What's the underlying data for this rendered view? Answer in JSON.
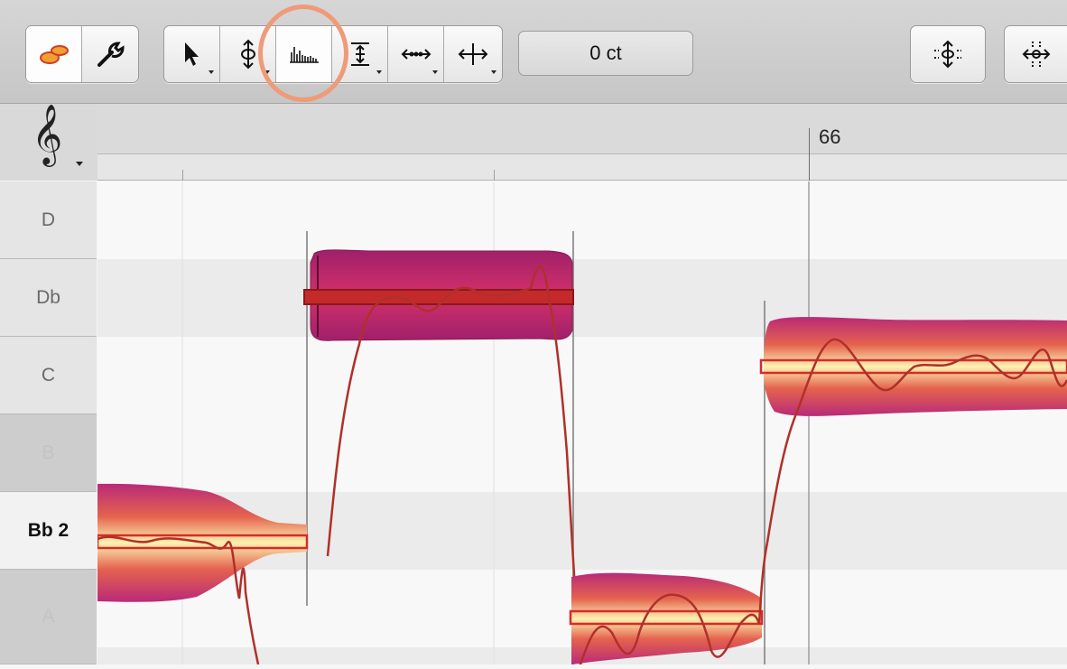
{
  "toolbar": {
    "groups": [
      {
        "id": "mode",
        "buttons": [
          {
            "icon": "blob-notes-icon",
            "selected": true
          },
          {
            "icon": "wrench-icon",
            "selected": false
          }
        ]
      },
      {
        "id": "tools",
        "buttons": [
          {
            "icon": "arrow-pointer-icon",
            "has_menu": true
          },
          {
            "icon": "pitch-tool-icon",
            "has_menu": true
          },
          {
            "icon": "pitch-drift-bars-icon",
            "has_menu": false,
            "selected": true,
            "highlighted": true
          },
          {
            "icon": "amplitude-tool-icon",
            "has_menu": true
          },
          {
            "icon": "time-tool-icon",
            "has_menu": true
          },
          {
            "icon": "move-tool-icon",
            "has_menu": true
          }
        ]
      },
      {
        "id": "quantize",
        "buttons": [
          {
            "icon": "pitch-quantize-icon"
          }
        ]
      },
      {
        "id": "time-quantize",
        "buttons": [
          {
            "icon": "time-quantize-icon"
          }
        ]
      }
    ],
    "cents_value": "0 ct",
    "highlight_color": "#ef9a78"
  },
  "clef": {
    "symbol": "𝄞",
    "icon": "treble-clef-icon"
  },
  "ruler": {
    "bar_number": "66"
  },
  "piano_keys": [
    {
      "label": "D",
      "type": "white"
    },
    {
      "label": "Db",
      "type": "black"
    },
    {
      "label": "C",
      "type": "white"
    },
    {
      "label": "B",
      "type": "white"
    },
    {
      "label": "Bb 2",
      "type": "black",
      "active": true
    },
    {
      "label": "A",
      "type": "white"
    }
  ],
  "colors": {
    "note_outer": "#b92a78",
    "note_mid": "#e5634e",
    "note_core": "#fbf2b0",
    "note_selected": "#c8256c",
    "pitch_bar": "#d62b2b",
    "pitch_curve": "#b0302a"
  }
}
